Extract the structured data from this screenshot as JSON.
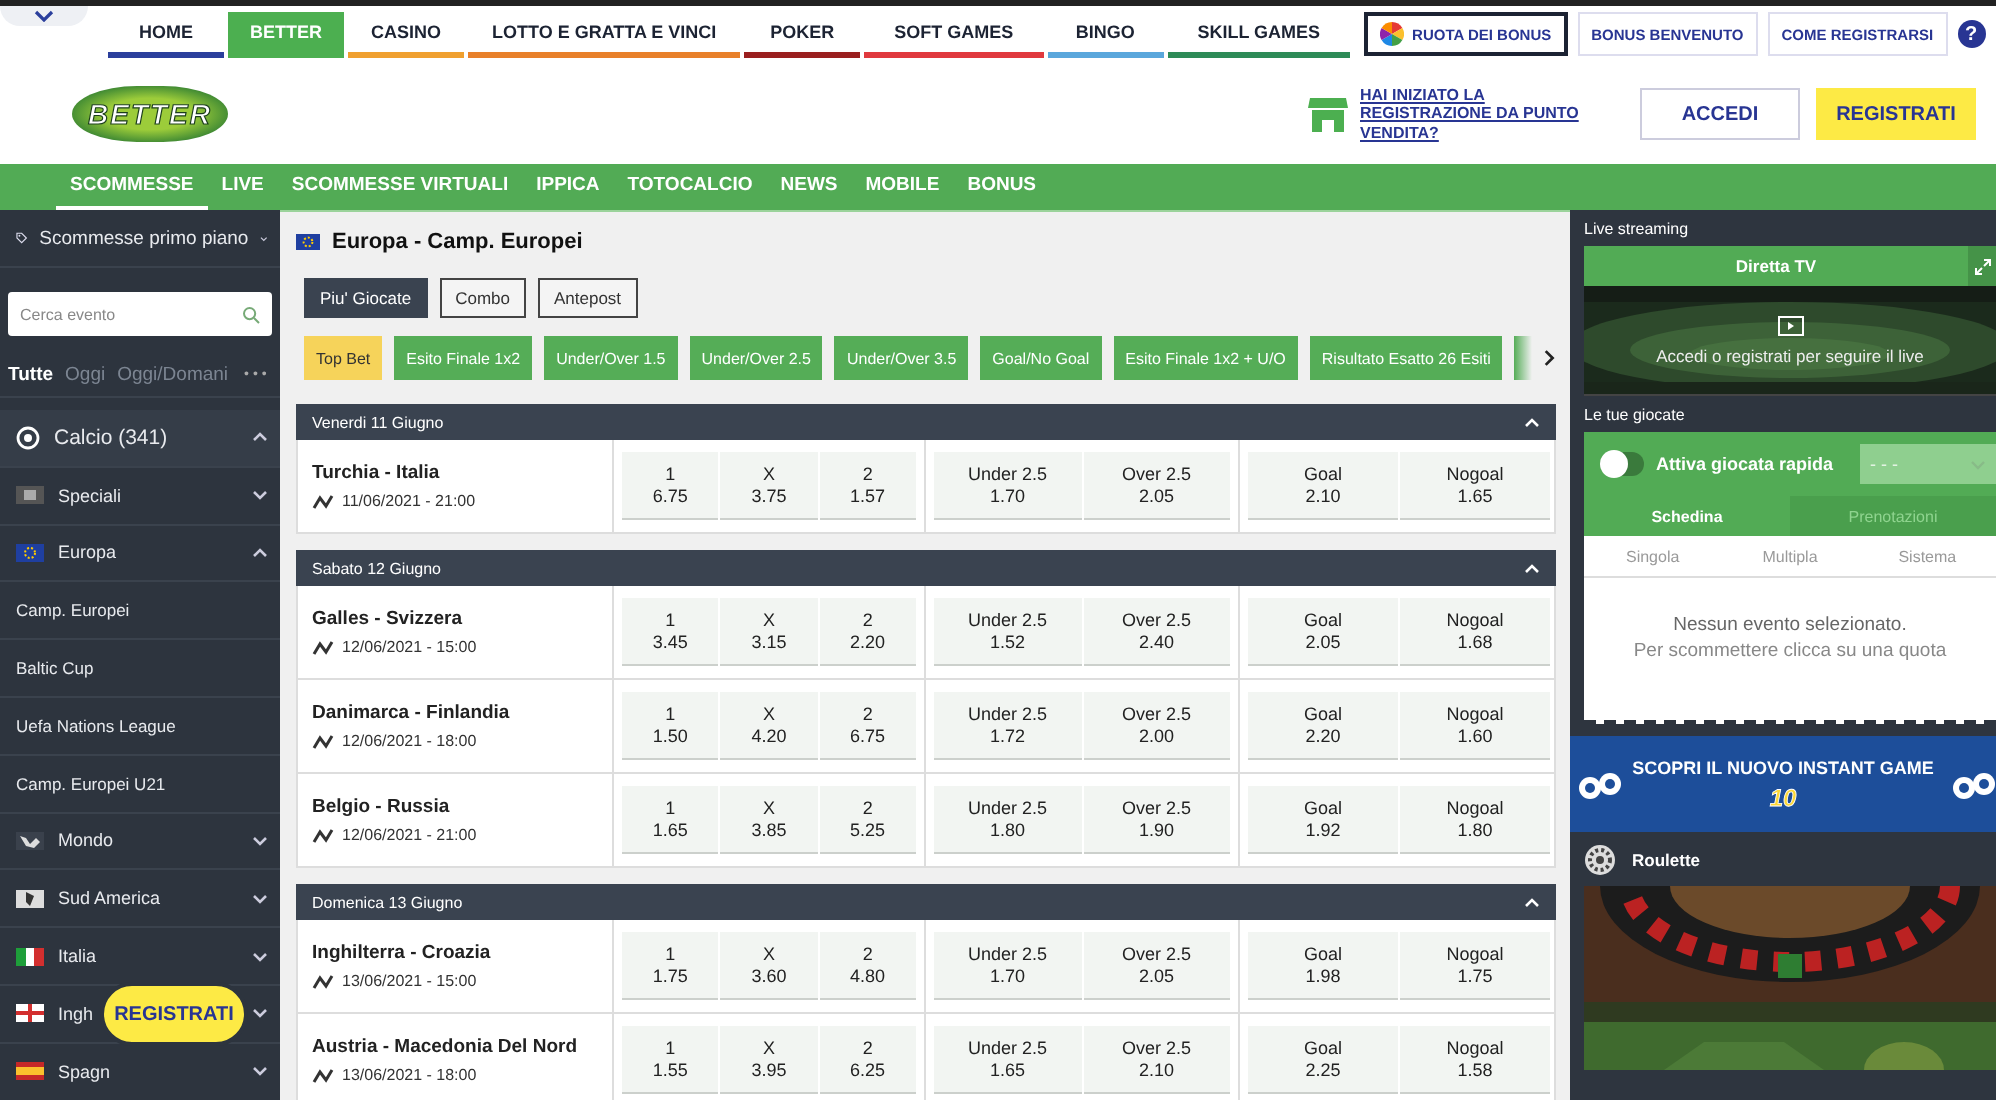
{
  "top_nav": {
    "tabs": [
      {
        "label": "HOME",
        "selected": false,
        "color": "#2b3f9c"
      },
      {
        "label": "BETTER",
        "selected": true,
        "color": "#4caf50"
      },
      {
        "label": "CASINO",
        "selected": false,
        "color": "#f0a030"
      },
      {
        "label": "LOTTO E GRATTA E VINCI",
        "selected": false,
        "color": "#e8802a"
      },
      {
        "label": "POKER",
        "selected": false,
        "color": "#9a1f1f"
      },
      {
        "label": "SOFT GAMES",
        "selected": false,
        "color": "#e0393e"
      },
      {
        "label": "BINGO",
        "selected": false,
        "color": "#5aa7dc"
      },
      {
        "label": "SKILL GAMES",
        "selected": false,
        "color": "#2e8b57"
      }
    ],
    "buttons": [
      {
        "label": "RUOTA DEI BONUS",
        "kind": "wheel"
      },
      {
        "label": "BONUS BENVENUTO",
        "kind": "plain"
      },
      {
        "label": "COME REGISTRARSI",
        "kind": "plain"
      }
    ],
    "help": "?"
  },
  "header": {
    "logo": "BETTER",
    "store_link": "HAI INIZIATO LA REGISTRAZIONE DA PUNTO VENDITA?",
    "login": "ACCEDI",
    "register": "REGISTRATI"
  },
  "sub_nav": [
    {
      "label": "SCOMMESSE",
      "selected": true
    },
    {
      "label": "LIVE",
      "selected": false
    },
    {
      "label": "SCOMMESSE VIRTUALI",
      "selected": false
    },
    {
      "label": "IPPICA",
      "selected": false
    },
    {
      "label": "TOTOCALCIO",
      "selected": false
    },
    {
      "label": "NEWS",
      "selected": false
    },
    {
      "label": "MOBILE",
      "selected": false
    },
    {
      "label": "BONUS",
      "selected": false
    }
  ],
  "sidebar": {
    "featured": "Scommesse primo piano",
    "search": {
      "placeholder": "Cerca evento"
    },
    "filters": [
      {
        "label": "Tutte",
        "selected": true
      },
      {
        "label": "Oggi",
        "selected": false
      },
      {
        "label": "Oggi/Domani",
        "selected": false
      }
    ],
    "more": "• • •",
    "items": [
      {
        "kind": "sport",
        "label": "Calcio (341)",
        "expanded": true
      },
      {
        "kind": "region",
        "label": "Speciali",
        "expanded": false
      },
      {
        "kind": "region",
        "label": "Europa",
        "expanded": true
      },
      {
        "kind": "league",
        "label": "Camp. Europei"
      },
      {
        "kind": "league",
        "label": "Baltic Cup"
      },
      {
        "kind": "league",
        "label": "Uefa Nations League"
      },
      {
        "kind": "league",
        "label": "Camp. Europei U21"
      },
      {
        "kind": "region",
        "label": "Mondo",
        "expanded": false
      },
      {
        "kind": "region",
        "label": "Sud America",
        "expanded": false
      },
      {
        "kind": "region",
        "label": "Italia",
        "expanded": false
      },
      {
        "kind": "region",
        "label": "Ingh",
        "expanded": false
      },
      {
        "kind": "region",
        "label": "Spagn",
        "expanded": false
      }
    ],
    "floating_register": "REGISTRATI"
  },
  "main": {
    "title": "Europa - Camp. Europei",
    "view_tabs": [
      {
        "label": "Piu' Giocate",
        "selected": true
      },
      {
        "label": "Combo",
        "selected": false
      },
      {
        "label": "Antepost",
        "selected": false
      }
    ],
    "markets": [
      {
        "label": "Top Bet",
        "selected": true
      },
      {
        "label": "Esito Finale 1x2",
        "selected": false
      },
      {
        "label": "Under/Over 1.5",
        "selected": false
      },
      {
        "label": "Under/Over 2.5",
        "selected": false
      },
      {
        "label": "Under/Over 3.5",
        "selected": false
      },
      {
        "label": "Goal/No Goal",
        "selected": false
      },
      {
        "label": "Esito Finale 1x2 + U/O",
        "selected": false
      },
      {
        "label": "Risultato Esatto 26 Esiti",
        "selected": false
      }
    ],
    "days": [
      {
        "label": "Venerdi 11 Giugno",
        "expanded": true,
        "matches": [
          {
            "teams": "Turchia - Italia",
            "time": "11/06/2021 - 21:00",
            "odds": [
              [
                {
                  "label": "1",
                  "value": "6.75"
                },
                {
                  "label": "X",
                  "value": "3.75"
                },
                {
                  "label": "2",
                  "value": "1.57"
                }
              ],
              [
                {
                  "label": "Under 2.5",
                  "value": "1.70"
                },
                {
                  "label": "Over 2.5",
                  "value": "2.05"
                }
              ],
              [
                {
                  "label": "Goal",
                  "value": "2.10"
                },
                {
                  "label": "Nogoal",
                  "value": "1.65"
                }
              ]
            ]
          }
        ]
      },
      {
        "label": "Sabato 12 Giugno",
        "expanded": true,
        "matches": [
          {
            "teams": "Galles - Svizzera",
            "time": "12/06/2021 - 15:00",
            "odds": [
              [
                {
                  "label": "1",
                  "value": "3.45"
                },
                {
                  "label": "X",
                  "value": "3.15"
                },
                {
                  "label": "2",
                  "value": "2.20"
                }
              ],
              [
                {
                  "label": "Under 2.5",
                  "value": "1.52"
                },
                {
                  "label": "Over 2.5",
                  "value": "2.40"
                }
              ],
              [
                {
                  "label": "Goal",
                  "value": "2.05"
                },
                {
                  "label": "Nogoal",
                  "value": "1.68"
                }
              ]
            ]
          },
          {
            "teams": "Danimarca - Finlandia",
            "time": "12/06/2021 - 18:00",
            "odds": [
              [
                {
                  "label": "1",
                  "value": "1.50"
                },
                {
                  "label": "X",
                  "value": "4.20"
                },
                {
                  "label": "2",
                  "value": "6.75"
                }
              ],
              [
                {
                  "label": "Under 2.5",
                  "value": "1.72"
                },
                {
                  "label": "Over 2.5",
                  "value": "2.00"
                }
              ],
              [
                {
                  "label": "Goal",
                  "value": "2.20"
                },
                {
                  "label": "Nogoal",
                  "value": "1.60"
                }
              ]
            ]
          },
          {
            "teams": "Belgio - Russia",
            "time": "12/06/2021 - 21:00",
            "odds": [
              [
                {
                  "label": "1",
                  "value": "1.65"
                },
                {
                  "label": "X",
                  "value": "3.85"
                },
                {
                  "label": "2",
                  "value": "5.25"
                }
              ],
              [
                {
                  "label": "Under 2.5",
                  "value": "1.80"
                },
                {
                  "label": "Over 2.5",
                  "value": "1.90"
                }
              ],
              [
                {
                  "label": "Goal",
                  "value": "1.92"
                },
                {
                  "label": "Nogoal",
                  "value": "1.80"
                }
              ]
            ]
          }
        ]
      },
      {
        "label": "Domenica 13 Giugno",
        "expanded": true,
        "matches": [
          {
            "teams": "Inghilterra - Croazia",
            "time": "13/06/2021 - 15:00",
            "odds": [
              [
                {
                  "label": "1",
                  "value": "1.75"
                },
                {
                  "label": "X",
                  "value": "3.60"
                },
                {
                  "label": "2",
                  "value": "4.80"
                }
              ],
              [
                {
                  "label": "Under 2.5",
                  "value": "1.70"
                },
                {
                  "label": "Over 2.5",
                  "value": "2.05"
                }
              ],
              [
                {
                  "label": "Goal",
                  "value": "1.98"
                },
                {
                  "label": "Nogoal",
                  "value": "1.75"
                }
              ]
            ]
          },
          {
            "teams": "Austria - Macedonia Del Nord",
            "time": "13/06/2021 - 18:00",
            "odds": [
              [
                {
                  "label": "1",
                  "value": "1.55"
                },
                {
                  "label": "X",
                  "value": "3.95"
                },
                {
                  "label": "2",
                  "value": "6.25"
                }
              ],
              [
                {
                  "label": "Under 2.5",
                  "value": "1.65"
                },
                {
                  "label": "Over 2.5",
                  "value": "2.10"
                }
              ],
              [
                {
                  "label": "Goal",
                  "value": "2.25"
                },
                {
                  "label": "Nogoal",
                  "value": "1.58"
                }
              ]
            ]
          }
        ]
      }
    ]
  },
  "right": {
    "live": {
      "title": "Live streaming",
      "tv": "Diretta TV",
      "message": "Accedi o registrati per seguire il live"
    },
    "bets": {
      "title": "Le tue giocate",
      "quick_toggle": {
        "label": "Attiva giocata rapida",
        "on": false
      },
      "amount": "- - -",
      "tabs": [
        {
          "label": "Schedina",
          "selected": true
        },
        {
          "label": "Prenotazioni",
          "selected": false
        }
      ],
      "types": [
        {
          "label": "Singola",
          "selected": false
        },
        {
          "label": "Multipla",
          "selected": false
        },
        {
          "label": "Sistema",
          "selected": false
        }
      ],
      "empty_title": "Nessun evento selezionato.",
      "empty_text": "Per scommettere clicca su una quota"
    },
    "banner": {
      "title": "SCOPRI IL NUOVO INSTANT GAME",
      "logo": "10"
    },
    "roulette": {
      "title": "Roulette"
    }
  }
}
